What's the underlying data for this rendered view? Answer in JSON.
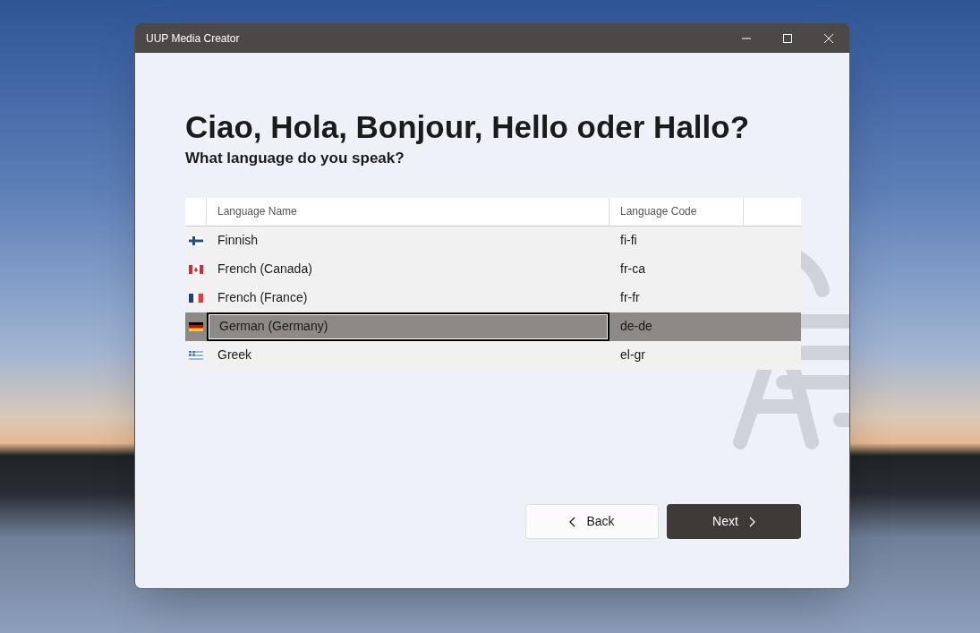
{
  "window": {
    "title": "UUP Media Creator"
  },
  "heading": "Ciao, Hola, Bonjour, Hello oder Hallo?",
  "subheading": "What language do you speak?",
  "table": {
    "columns": [
      "Language Name",
      "Language Code"
    ],
    "rows": [
      {
        "kind": "fi",
        "name": "Finnish",
        "code": "fi-fi",
        "selected": false
      },
      {
        "kind": "ca",
        "name": "French (Canada)",
        "code": "fr-ca",
        "selected": false
      },
      {
        "kind": "fr",
        "name": "French (France)",
        "code": "fr-fr",
        "selected": false
      },
      {
        "kind": "de",
        "name": "German (Germany)",
        "code": "de-de",
        "selected": true
      },
      {
        "kind": "gr",
        "name": "Greek",
        "code": "el-gr",
        "selected": false
      }
    ]
  },
  "buttons": {
    "back": "Back",
    "next": "Next"
  }
}
